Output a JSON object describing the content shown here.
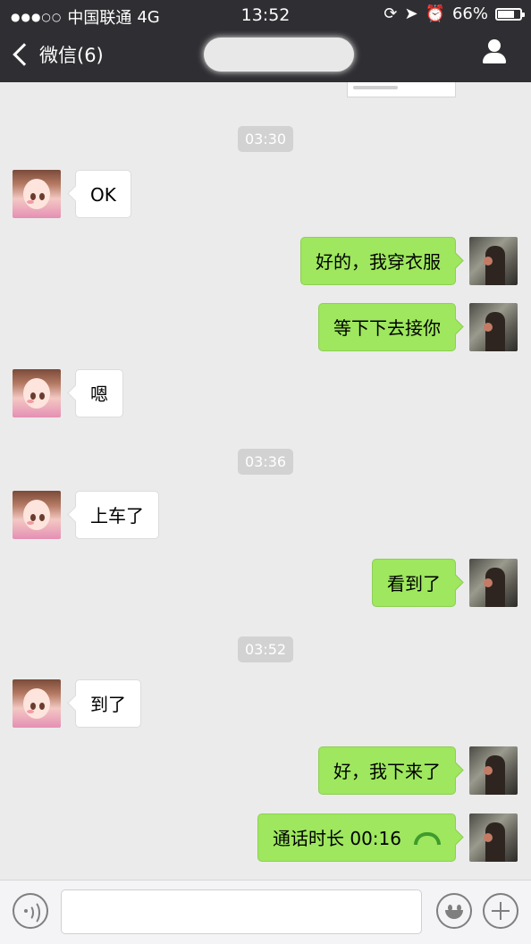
{
  "status_bar": {
    "signal": "●●●○○",
    "carrier": "中国联通",
    "network": "4G",
    "time": "13:52",
    "battery": "66%"
  },
  "nav": {
    "back_label": "微信(6)"
  },
  "messages": {
    "t1": "03:30",
    "m1": "OK",
    "m2": "好的，我穿衣服",
    "m3": "等下下去接你",
    "m4": "嗯",
    "t2": "03:36",
    "m5": "上车了",
    "m6": "看到了",
    "t3": "03:52",
    "m7": "到了",
    "m8": "好，我下来了",
    "m9": "通话时长 00:16"
  },
  "colors": {
    "nav_bg": "#2f2f33",
    "chat_bg": "#ebebeb",
    "outgoing_bubble": "#9ee75e",
    "incoming_bubble": "#ffffff"
  },
  "icons": {
    "back": "chevron-left-icon",
    "profile": "user-icon",
    "call": "phone-hangup-icon",
    "voice": "voice-icon",
    "emoji": "emoji-icon",
    "more": "plus-icon"
  }
}
